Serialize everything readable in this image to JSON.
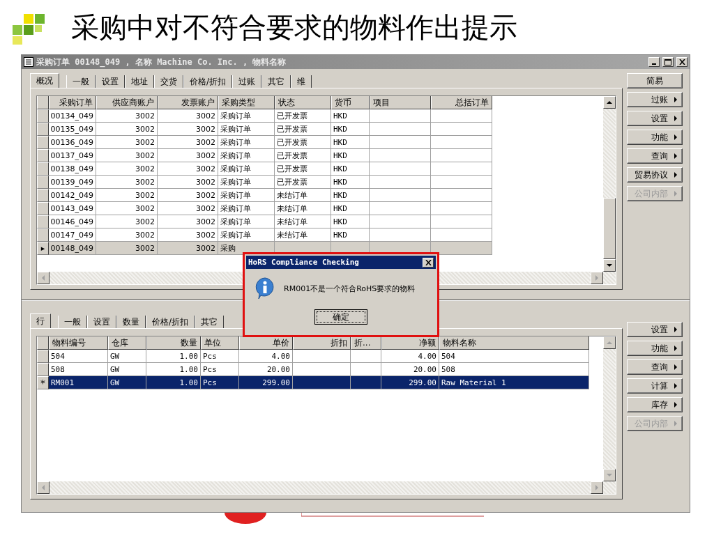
{
  "slide": {
    "title": "采购中对不符合要求的物料作出提示"
  },
  "window": {
    "title": "采购订单 00148_049 , 名称 Machine Co. Inc. , 物料名称"
  },
  "upper": {
    "tabs": [
      {
        "label": "概况",
        "selected": true
      },
      {
        "label": "一般",
        "selected": false
      },
      {
        "label": "设置",
        "selected": false
      },
      {
        "label": "地址",
        "selected": false
      },
      {
        "label": "交货",
        "selected": false
      },
      {
        "label": "价格/折扣",
        "selected": false
      },
      {
        "label": "过账",
        "selected": false
      },
      {
        "label": "其它",
        "selected": false
      },
      {
        "label": "维",
        "selected": false
      }
    ],
    "row_marker": "▸",
    "columns": [
      "采购订单",
      "供应商账户",
      "发票账户",
      "采购类型",
      "状态",
      "货币",
      "项目",
      "总括订单"
    ],
    "rows": [
      {
        "cells": [
          "00134_049",
          "3002",
          "3002",
          "采购订单",
          "已开发票",
          "HKD"
        ],
        "selected": false
      },
      {
        "cells": [
          "00135_049",
          "3002",
          "3002",
          "采购订单",
          "已开发票",
          "HKD"
        ],
        "selected": false
      },
      {
        "cells": [
          "00136_049",
          "3002",
          "3002",
          "采购订单",
          "已开发票",
          "HKD"
        ],
        "selected": false
      },
      {
        "cells": [
          "00137_049",
          "3002",
          "3002",
          "采购订单",
          "已开发票",
          "HKD"
        ],
        "selected": false
      },
      {
        "cells": [
          "00138_049",
          "3002",
          "3002",
          "采购订单",
          "已开发票",
          "HKD"
        ],
        "selected": false
      },
      {
        "cells": [
          "00139_049",
          "3002",
          "3002",
          "采购订单",
          "已开发票",
          "HKD"
        ],
        "selected": false
      },
      {
        "cells": [
          "00142_049",
          "3002",
          "3002",
          "采购订单",
          "未结订单",
          "HKD"
        ],
        "selected": false
      },
      {
        "cells": [
          "00143_049",
          "3002",
          "3002",
          "采购订单",
          "未结订单",
          "HKD"
        ],
        "selected": false
      },
      {
        "cells": [
          "00146_049",
          "3002",
          "3002",
          "采购订单",
          "未结订单",
          "HKD"
        ],
        "selected": false
      },
      {
        "cells": [
          "00147_049",
          "3002",
          "3002",
          "采购订单",
          "未结订单",
          "HKD"
        ],
        "selected": false
      },
      {
        "cells": [
          "00148_049",
          "3002",
          "3002",
          "采购"
        ],
        "selected": true
      }
    ],
    "buttons": [
      {
        "label": "简易",
        "submenu": false,
        "disabled": false
      },
      {
        "label": "过账",
        "submenu": true,
        "disabled": false
      },
      {
        "label": "设置",
        "submenu": true,
        "disabled": false
      },
      {
        "label": "功能",
        "submenu": true,
        "disabled": false
      },
      {
        "label": "查询",
        "submenu": true,
        "disabled": false
      },
      {
        "label": "贸易协议",
        "submenu": true,
        "disabled": false
      },
      {
        "label": "公司内部",
        "submenu": true,
        "disabled": true
      }
    ]
  },
  "lower": {
    "tabs": [
      {
        "label": "行",
        "selected": true
      },
      {
        "label": "一般",
        "selected": false
      },
      {
        "label": "设置",
        "selected": false
      },
      {
        "label": "数量",
        "selected": false
      },
      {
        "label": "价格/折扣",
        "selected": false
      },
      {
        "label": "其它",
        "selected": false
      }
    ],
    "row_marker": "*",
    "columns": [
      "物料编号",
      "仓库",
      "数量",
      "单位",
      "单价",
      "折扣",
      "折...",
      "净额",
      "物料名称"
    ],
    "rows": [
      {
        "cells": [
          "504",
          "GW",
          "1.00",
          "Pcs",
          "4.00",
          "",
          "",
          "4.00",
          "504"
        ],
        "selected": false
      },
      {
        "cells": [
          "508",
          "GW",
          "1.00",
          "Pcs",
          "20.00",
          "",
          "",
          "20.00",
          "508"
        ],
        "selected": false
      },
      {
        "cells": [
          "RM001",
          "GW",
          "1.00",
          "Pcs",
          "299.00",
          "",
          "",
          "299.00",
          "Raw Material 1"
        ],
        "selected": true
      }
    ],
    "buttons": [
      {
        "label": "设置",
        "submenu": true,
        "disabled": false
      },
      {
        "label": "功能",
        "submenu": true,
        "disabled": false
      },
      {
        "label": "查询",
        "submenu": true,
        "disabled": false
      },
      {
        "label": "计算",
        "submenu": true,
        "disabled": false
      },
      {
        "label": "库存",
        "submenu": true,
        "disabled": false
      },
      {
        "label": "公司内部",
        "submenu": true,
        "disabled": true
      }
    ]
  },
  "dialog": {
    "title": "HoRS Compliance Checking",
    "message": "RM001不是一个符合RoHS要求的物料",
    "ok": "确定"
  }
}
